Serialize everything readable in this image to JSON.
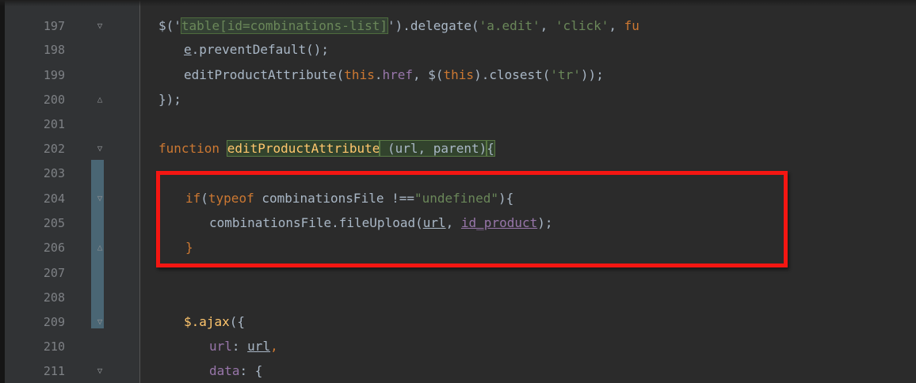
{
  "editor": {
    "colors": {
      "background": "#2b2b2b",
      "gutter": "#313335",
      "keyword": "#cc7832",
      "string": "#6a8759",
      "function_name": "#ffc66d",
      "property": "#9876aa",
      "plain": "#a9b7c6",
      "line_number": "#7e8185",
      "annotation_box": "#f41612"
    },
    "lines": [
      {
        "num": "197",
        "fold": "open",
        "tokens": [
          "$('",
          "table[id=combinations-list]",
          "').delegate(",
          "'a.edit'",
          ", ",
          "'click'",
          ", ",
          "fu"
        ]
      },
      {
        "num": "198",
        "fold": "none",
        "tokens": [
          "e",
          ".preventDefault();"
        ]
      },
      {
        "num": "199",
        "fold": "none",
        "tokens": [
          "editProductAttribute(",
          "this",
          ".",
          "href",
          ", $(",
          "this",
          ").closest(",
          "'tr'",
          "));"
        ]
      },
      {
        "num": "200",
        "fold": "close",
        "tokens": [
          "});"
        ]
      },
      {
        "num": "201",
        "fold": "none",
        "tokens": []
      },
      {
        "num": "202",
        "fold": "open",
        "tokens": [
          "function ",
          "editProductAttribute",
          " (url, parent)",
          "{"
        ]
      },
      {
        "num": "203",
        "fold": "none",
        "tokens": []
      },
      {
        "num": "204",
        "fold": "open",
        "tokens": [
          "if",
          "(",
          "typeof",
          " combinationsFile !==",
          "\"undefined\"",
          "){"
        ]
      },
      {
        "num": "205",
        "fold": "none",
        "tokens": [
          "combinationsFile.",
          "fileUpload",
          "(",
          "url",
          ", ",
          "id_product",
          ");"
        ]
      },
      {
        "num": "206",
        "fold": "close",
        "tokens": [
          "}"
        ]
      },
      {
        "num": "207",
        "fold": "none",
        "tokens": []
      },
      {
        "num": "208",
        "fold": "none",
        "tokens": []
      },
      {
        "num": "209",
        "fold": "open",
        "tokens": [
          "$.ajax",
          "({"
        ]
      },
      {
        "num": "210",
        "fold": "none",
        "tokens": [
          "url",
          ": ",
          "url",
          ","
        ]
      },
      {
        "num": "211",
        "fold": "open",
        "tokens": [
          "data",
          ": {"
        ]
      }
    ]
  }
}
